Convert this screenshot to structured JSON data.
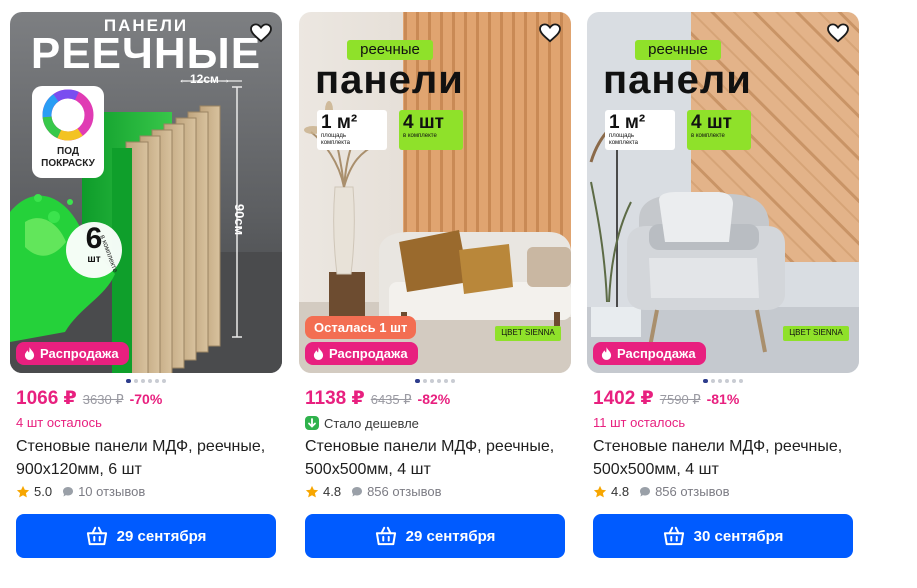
{
  "products": [
    {
      "price": "1066 ₽",
      "old_price": "3630 ₽",
      "discount": "-70%",
      "stock": "4 шт осталось",
      "title": "Стеновые панели МДФ, реечные, 900х120мм, 6 шт",
      "rating": "5.0",
      "reviews": "10 отзывов",
      "delivery": "29 сентября",
      "sale_badge": "Распродажа",
      "image_text": {
        "line1": "ПАНЕЛИ",
        "line2": "РЕЕЧНЫЕ",
        "width": "12см",
        "height": "90см",
        "paint_tag": "ПОД ПОКРАСКУ",
        "count": "6",
        "count_unit": "шт",
        "ring": "в комплекте"
      }
    },
    {
      "price": "1138 ₽",
      "old_price": "6435 ₽",
      "discount": "-82%",
      "cheaper": "Стало дешевле",
      "title": "Стеновые панели МДФ, реечные, 500х500мм, 4 шт",
      "rating": "4.8",
      "reviews": "856 отзывов",
      "delivery": "29 сентября",
      "sale_badge": "Распродажа",
      "left_badge": "Осталась 1 шт",
      "image_text": {
        "tag": "реечные",
        "headline": "панели",
        "area": "1 м²",
        "area_caption": "площадь комплекта",
        "qty": "4 шт",
        "qty_caption": "в комплекте",
        "color": "ЦВЕТ SIENNA"
      }
    },
    {
      "price": "1402 ₽",
      "old_price": "7590 ₽",
      "discount": "-81%",
      "stock": "11 шт осталось",
      "title": "Стеновые панели МДФ, реечные, 500х500мм, 4 шт",
      "rating": "4.8",
      "reviews": "856 отзывов",
      "delivery": "30 сентября",
      "sale_badge": "Распродажа",
      "image_text": {
        "tag": "реечные",
        "headline": "панели",
        "area": "1 м²",
        "area_caption": "площадь комплекта",
        "qty": "4 шт",
        "qty_caption": "в комплекте",
        "color": "ЦВЕТ SIENNA"
      }
    }
  ],
  "colors": {
    "accent_pink": "#e8207f",
    "button_blue": "#005bff",
    "badge_orange": "#f36e52",
    "green_promo": "#7ddc1f"
  },
  "icons": [
    "heart-icon",
    "flame-icon",
    "basket-icon",
    "star-icon",
    "chat-bubble-icon",
    "price-down-icon"
  ]
}
